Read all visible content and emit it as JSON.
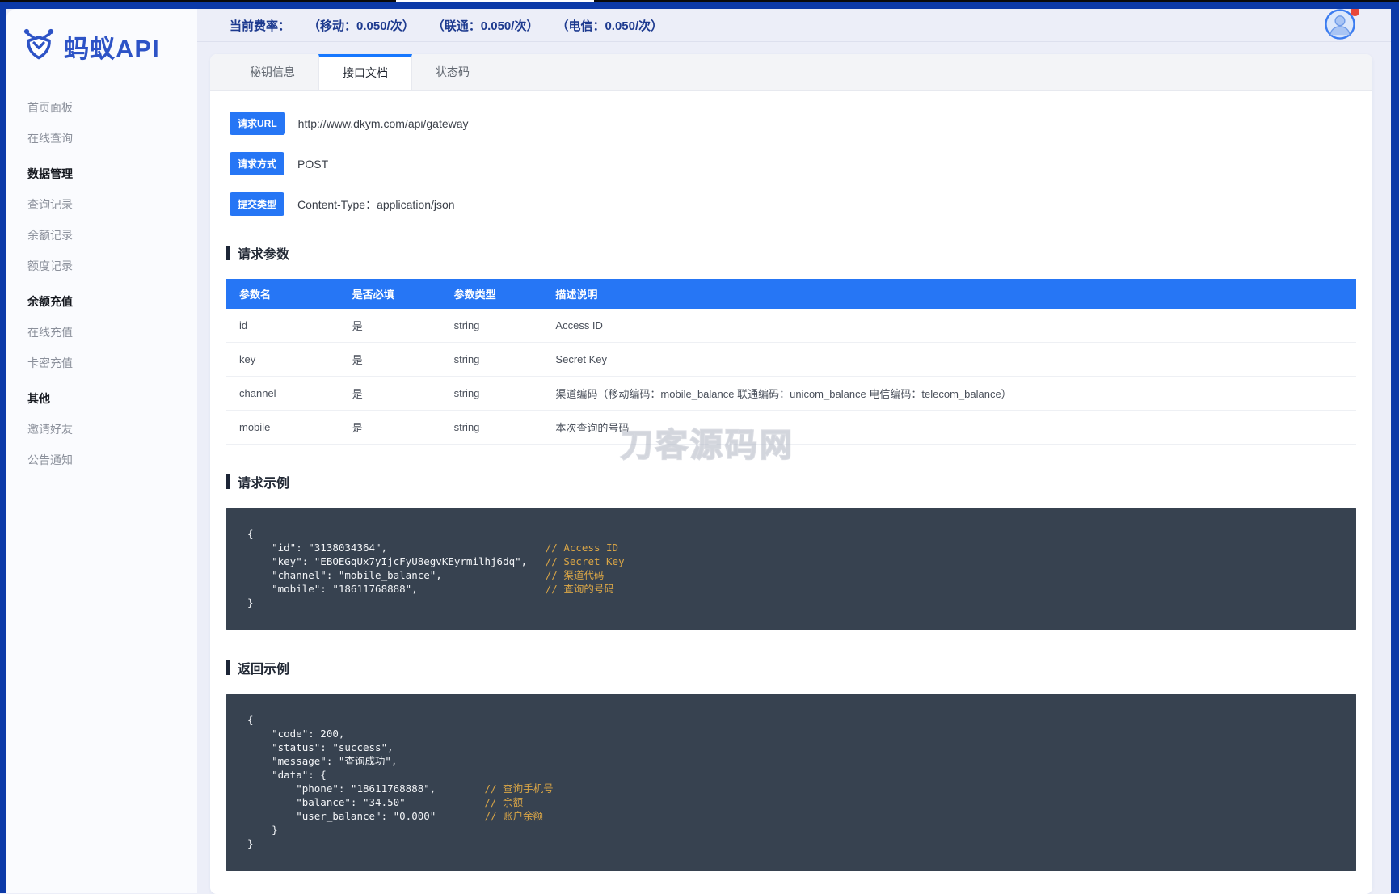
{
  "topbar": {
    "rates_label": "当前费率：",
    "rates": [
      "（移动：0.050/次）",
      "（联通：0.050/次）",
      "（电信：0.050/次）"
    ]
  },
  "logo": {
    "text": "蚂蚁API"
  },
  "sidebar": {
    "items": [
      {
        "type": "link",
        "label": "首页面板"
      },
      {
        "type": "link",
        "label": "在线查询"
      },
      {
        "type": "header",
        "label": "数据管理"
      },
      {
        "type": "link",
        "label": "查询记录"
      },
      {
        "type": "link",
        "label": "余额记录"
      },
      {
        "type": "link",
        "label": "额度记录"
      },
      {
        "type": "header",
        "label": "余额充值"
      },
      {
        "type": "link",
        "label": "在线充值"
      },
      {
        "type": "link",
        "label": "卡密充值"
      },
      {
        "type": "header",
        "label": "其他"
      },
      {
        "type": "link",
        "label": "邀请好友"
      },
      {
        "type": "link",
        "label": "公告通知"
      }
    ]
  },
  "tabs": [
    {
      "label": "秘钥信息",
      "active": false
    },
    {
      "label": "接口文档",
      "active": true
    },
    {
      "label": "状态码",
      "active": false
    }
  ],
  "request_info": [
    {
      "label": "请求URL",
      "value": "http://www.dkym.com/api/gateway"
    },
    {
      "label": "请求方式",
      "value": "POST"
    },
    {
      "label": "提交类型",
      "value": "Content-Type：application/json"
    }
  ],
  "params": {
    "title": "请求参数",
    "headers": [
      "参数名",
      "是否必填",
      "参数类型",
      "描述说明"
    ],
    "rows": [
      {
        "name": "id",
        "required": "是",
        "type": "string",
        "desc": "Access ID"
      },
      {
        "name": "key",
        "required": "是",
        "type": "string",
        "desc": "Secret Key"
      },
      {
        "name": "channel",
        "required": "是",
        "type": "string",
        "desc": "渠道编码（移动编码：mobile_balance 联通编码：unicom_balance 电信编码：telecom_balance）"
      },
      {
        "name": "mobile",
        "required": "是",
        "type": "string",
        "desc": "本次查询的号码"
      }
    ]
  },
  "request_example": {
    "title": "请求示例",
    "lines": [
      {
        "code": "{",
        "comment": ""
      },
      {
        "code": "    \"id\": \"3138034364\",                          ",
        "comment": "// Access ID"
      },
      {
        "code": "    \"key\": \"EBOEGqUx7yIjcFyU8egvKEyrmilhj6dq\",   ",
        "comment": "// Secret Key"
      },
      {
        "code": "    \"channel\": \"mobile_balance\",                 ",
        "comment": "// 渠道代码"
      },
      {
        "code": "    \"mobile\": \"18611768888\",                     ",
        "comment": "// 查询的号码"
      },
      {
        "code": "}",
        "comment": ""
      }
    ]
  },
  "response_example": {
    "title": "返回示例",
    "lines": [
      {
        "code": "{",
        "comment": ""
      },
      {
        "code": "    \"code\": 200,",
        "comment": ""
      },
      {
        "code": "    \"status\": \"success\",",
        "comment": ""
      },
      {
        "code": "    \"message\": \"查询成功\",",
        "comment": ""
      },
      {
        "code": "    \"data\": {",
        "comment": ""
      },
      {
        "code": "        \"phone\": \"18611768888\",        ",
        "comment": "// 查询手机号"
      },
      {
        "code": "        \"balance\": \"34.50\"             ",
        "comment": "// 余额"
      },
      {
        "code": "        \"user_balance\": \"0.000\"        ",
        "comment": "// 账户余额"
      },
      {
        "code": "    }",
        "comment": ""
      },
      {
        "code": "}",
        "comment": ""
      }
    ]
  },
  "watermark": "刀客源码网",
  "avatar": {
    "notification": true
  },
  "colors": {
    "frame_blue": "#0c3aa8",
    "accent_blue": "#2676f5",
    "tab_indicator_blue": "#1677ff",
    "logo_blue": "#2d53c6",
    "rates_navy": "#1d3a8f",
    "code_bg": "#374250",
    "comment_orange": "#d9a546",
    "notification_red": "#e8483b",
    "page_bg": "#eceef8"
  }
}
